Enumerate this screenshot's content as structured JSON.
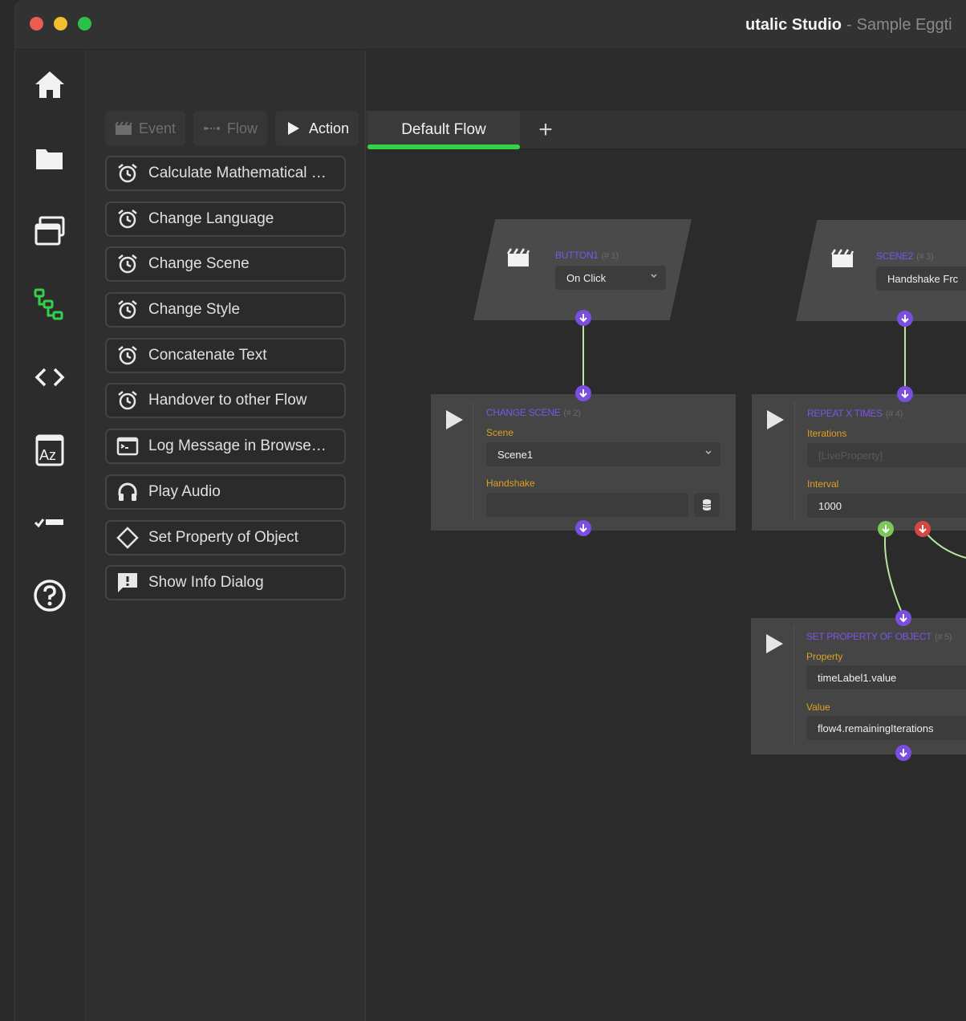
{
  "window": {
    "app_name": "utalic Studio",
    "separator": "-",
    "document_name": "Sample Eggti"
  },
  "rail": {
    "items": [
      {
        "name": "home-icon"
      },
      {
        "name": "folder-icon"
      },
      {
        "name": "windows-icon"
      },
      {
        "name": "flow-icon",
        "active": true,
        "color": "#35d04a"
      },
      {
        "name": "code-icon"
      },
      {
        "name": "translate-icon"
      },
      {
        "name": "checklist-icon"
      },
      {
        "name": "help-icon"
      }
    ]
  },
  "palette": {
    "tabs": [
      {
        "label": "Event",
        "icon": "clapper-icon",
        "active": false
      },
      {
        "label": "Flow",
        "icon": "flow-line-icon",
        "active": false
      },
      {
        "label": "Action",
        "icon": "play-icon",
        "active": true
      }
    ],
    "actions": [
      {
        "label": "Calculate Mathematical …",
        "icon": "alarm-icon"
      },
      {
        "label": "Change Language",
        "icon": "alarm-icon"
      },
      {
        "label": "Change Scene",
        "icon": "alarm-icon"
      },
      {
        "label": "Change Style",
        "icon": "alarm-icon"
      },
      {
        "label": "Concatenate Text",
        "icon": "alarm-icon"
      },
      {
        "label": "Handover to other Flow",
        "icon": "alarm-icon"
      },
      {
        "label": "Log Message in Browse…",
        "icon": "console-icon"
      },
      {
        "label": "Play Audio",
        "icon": "headphones-icon"
      },
      {
        "label": "Set Property of Object",
        "icon": "diamond-icon"
      },
      {
        "label": "Show Info Dialog",
        "icon": "info-dialog-icon"
      }
    ]
  },
  "canvas": {
    "tabs": [
      {
        "label": "Default Flow",
        "active": true
      }
    ],
    "add_label": "+",
    "nodes": {
      "button1": {
        "title": "BUTTON1",
        "id": "(# 1)",
        "select_value": "On Click"
      },
      "scene2": {
        "title": "SCENE2",
        "id": "(# 3)",
        "select_value": "Handshake Frc"
      },
      "change_scene": {
        "title": "CHANGE SCENE",
        "id": "(# 2)",
        "scene_label": "Scene",
        "scene_value": "Scene1",
        "handshake_label": "Handshake",
        "handshake_value": ""
      },
      "repeat": {
        "title": "REPEAT X TIMES",
        "id": "(# 4)",
        "iterations_label": "Iterations",
        "iterations_placeholder": "[LiveProperty]",
        "interval_label": "Interval",
        "interval_value": "1000"
      },
      "set_property": {
        "title": "SET PROPERTY OF OBJECT",
        "id": "(# 5)",
        "property_label": "Property",
        "property_value": "timeLabel1.value",
        "value_label": "Value",
        "value_value": "flow4.remainingIterations"
      }
    },
    "colors": {
      "port": "#7a4fe0",
      "port_success": "#7cc95a",
      "port_fail": "#d84545",
      "connector": "#b9e6a3",
      "node_title": "#7a55e8",
      "field_label": "#e0a020"
    }
  }
}
